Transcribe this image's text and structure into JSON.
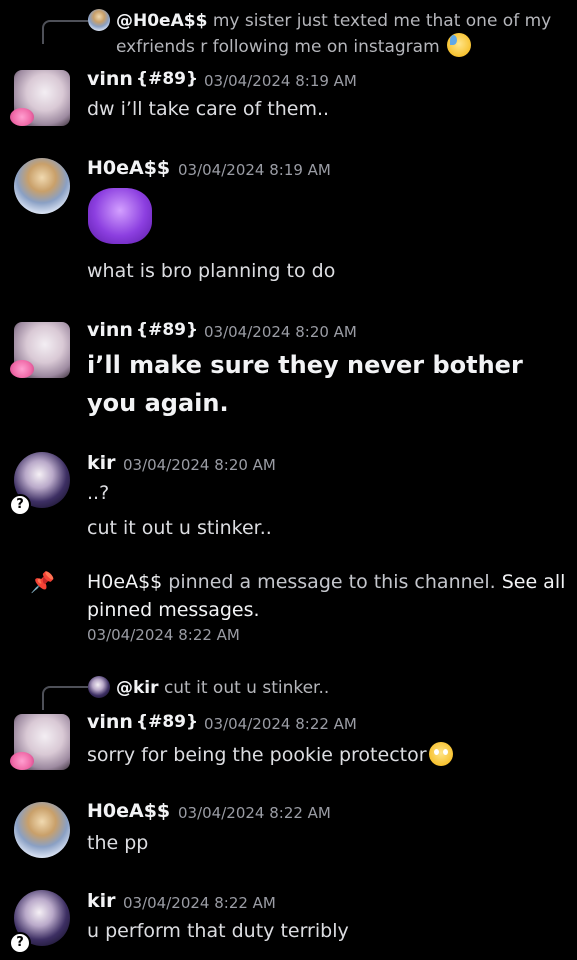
{
  "messages": {
    "reply1": {
      "mention": "@H0eA$$",
      "text": "my sister just texted me that one of my exfriends r following me on instagram",
      "emoji": "downcast-sweat-emoji"
    },
    "m1": {
      "name": "vinn",
      "tag": "{#89}",
      "time": "03/04/2024 8:19 AM",
      "text": "dw i’ll take care of them.."
    },
    "m2": {
      "name": "H0eA$$",
      "time": "03/04/2024 8:19 AM",
      "emote": "purple-blob-emote",
      "text": "what is bro planning to do"
    },
    "m3": {
      "name": "vinn",
      "tag": "{#89}",
      "time": "03/04/2024 8:20 AM",
      "text": "i’ll make sure they never bother you again."
    },
    "m4": {
      "name": "kir",
      "time": "03/04/2024 8:20 AM",
      "text1": "..?",
      "text2": "cut it out u stinker.."
    },
    "pin": {
      "actor": "H0eA$$",
      "text": " pinned a message to this channel. ",
      "link": "See all pinned messages.",
      "time": "03/04/2024 8:22 AM"
    },
    "reply2": {
      "mention": "@kir",
      "text": "cut it out u stinker.."
    },
    "m5": {
      "name": "vinn",
      "tag": "{#89}",
      "time": "03/04/2024 8:22 AM",
      "text": "sorry for being the pookie protector",
      "emoji": "eye-roll-emoji"
    },
    "m6": {
      "name": "H0eA$$",
      "time": "03/04/2024 8:22 AM",
      "text": "the pp"
    },
    "m7": {
      "name": "kir",
      "time": "03/04/2024 8:22 AM",
      "text": "u perform that duty terribly"
    }
  },
  "colors": {
    "background": "#000000",
    "text": "#dcdde1",
    "muted": "#9a9ca4",
    "name": "#f2f3f5"
  },
  "badge": "?"
}
